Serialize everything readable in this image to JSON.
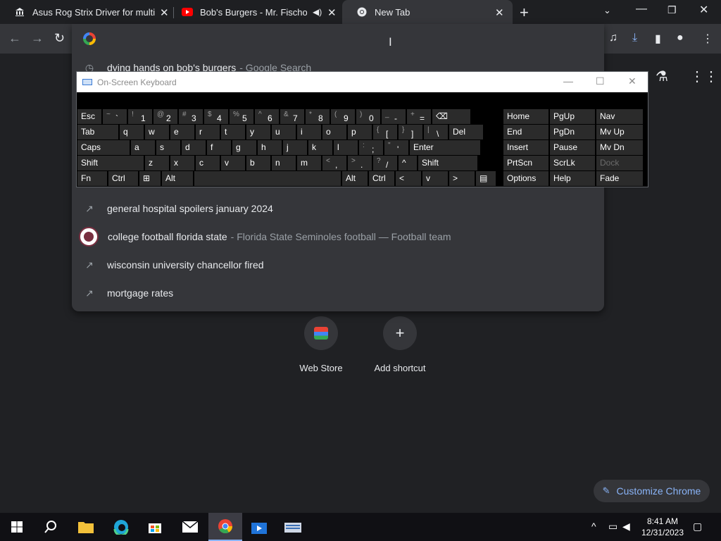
{
  "tabs": [
    {
      "title": "Asus Rog Strix Driver for multiple",
      "favicon": "bank-icon"
    },
    {
      "title": "Bob's Burgers - Mr. Fischoeder",
      "favicon": "youtube-icon",
      "audio": true
    },
    {
      "title": "New Tab",
      "favicon": "chrome-icon",
      "active": true
    }
  ],
  "omnibox": {
    "suggestions": [
      {
        "query": "dying hands on bob's burgers",
        "desc": "- Google Search",
        "icon": "history-icon"
      },
      {
        "query": "general hospital spoilers january 2024",
        "desc": "",
        "icon": "trending-icon"
      },
      {
        "query": "college football florida state",
        "desc": "- Florida State Seminoles football — Football team",
        "icon": "fsu-logo"
      },
      {
        "query": "wisconsin university chancellor fired",
        "desc": "",
        "icon": "trending-icon"
      },
      {
        "query": "mortgage rates",
        "desc": "",
        "icon": "trending-icon"
      }
    ]
  },
  "osk": {
    "title": "On-Screen Keyboard",
    "rows": [
      [
        "Esc",
        "~`",
        "!1",
        "@2",
        "#3",
        "$4",
        "%5",
        "^6",
        "&7",
        "*8",
        "(9",
        ")0",
        "_-",
        "+=",
        "⌫",
        "Home",
        "PgUp",
        "Nav"
      ],
      [
        "Tab",
        "q",
        "w",
        "e",
        "r",
        "t",
        "y",
        "u",
        "i",
        "o",
        "p",
        "{[",
        "}]",
        "|\\",
        "Del",
        "End",
        "PgDn",
        "Mv Up"
      ],
      [
        "Caps",
        "a",
        "s",
        "d",
        "f",
        "g",
        "h",
        "j",
        "k",
        "l",
        ":;",
        "\"'",
        "Enter",
        "Insert",
        "Pause",
        "Mv Dn"
      ],
      [
        "Shift",
        "z",
        "x",
        "c",
        "v",
        "b",
        "n",
        "m",
        "<,",
        ">.",
        "?/",
        "^",
        "Shift",
        "PrtScn",
        "ScrLk",
        "Dock"
      ],
      [
        "Fn",
        "Ctrl",
        "⊞",
        "Alt",
        "",
        "Alt",
        "Ctrl",
        "<",
        "v",
        ">",
        "▤",
        "Options",
        "Help",
        "Fade"
      ]
    ]
  },
  "newtab": {
    "shortcuts": [
      {
        "label": "Web Store",
        "icon": "web-store-icon"
      },
      {
        "label": "Add shortcut",
        "icon": "plus-icon"
      }
    ],
    "customize_label": "Customize Chrome"
  },
  "taskbar": {
    "time": "8:41 AM",
    "date": "12/31/2023"
  },
  "colors": {
    "background": "#202124",
    "toolbar": "#35363a",
    "accent": "#8ab4f8",
    "taskbar": "#101014"
  }
}
